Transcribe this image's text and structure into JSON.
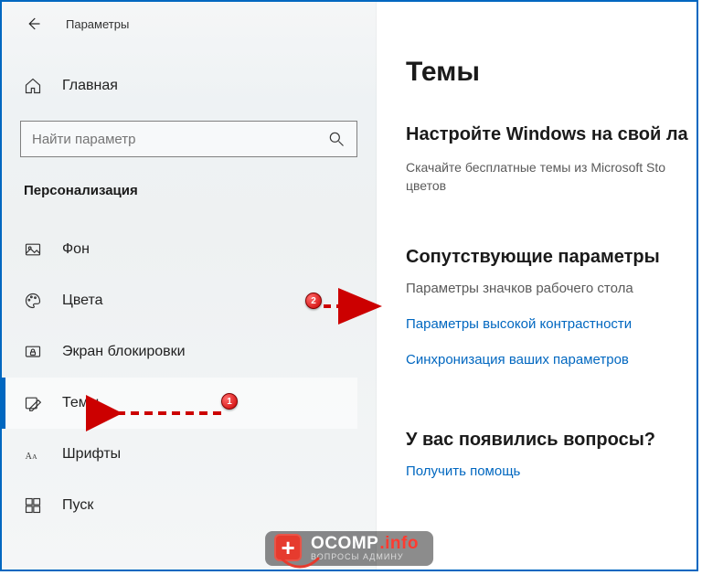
{
  "header": {
    "app_title": "Параметры"
  },
  "sidebar": {
    "home_label": "Главная",
    "search_placeholder": "Найти параметр",
    "category_title": "Персонализация",
    "items": [
      {
        "label": "Фон"
      },
      {
        "label": "Цвета"
      },
      {
        "label": "Экран блокировки"
      },
      {
        "label": "Темы"
      },
      {
        "label": "Шрифты"
      },
      {
        "label": "Пуск"
      }
    ],
    "selected_index": 3
  },
  "content": {
    "page_title": "Темы",
    "customize_heading": "Настройте Windows на свой ла",
    "customize_desc": "Скачайте бесплатные темы из Microsoft Sto\nцветов",
    "related_heading": "Сопутствующие параметры",
    "related_links": [
      "Параметры значков рабочего стола",
      "Параметры высокой контрастности",
      "Синхронизация ваших параметров"
    ],
    "help_heading": "У вас появились вопросы?",
    "help_link": "Получить помощь"
  },
  "annotations": {
    "badge1": "1",
    "badge2": "2"
  },
  "watermark": {
    "brand_main": "OCOMP",
    "brand_tld": ".info",
    "subtitle": "ВОПРОСЫ АДМИНУ"
  }
}
